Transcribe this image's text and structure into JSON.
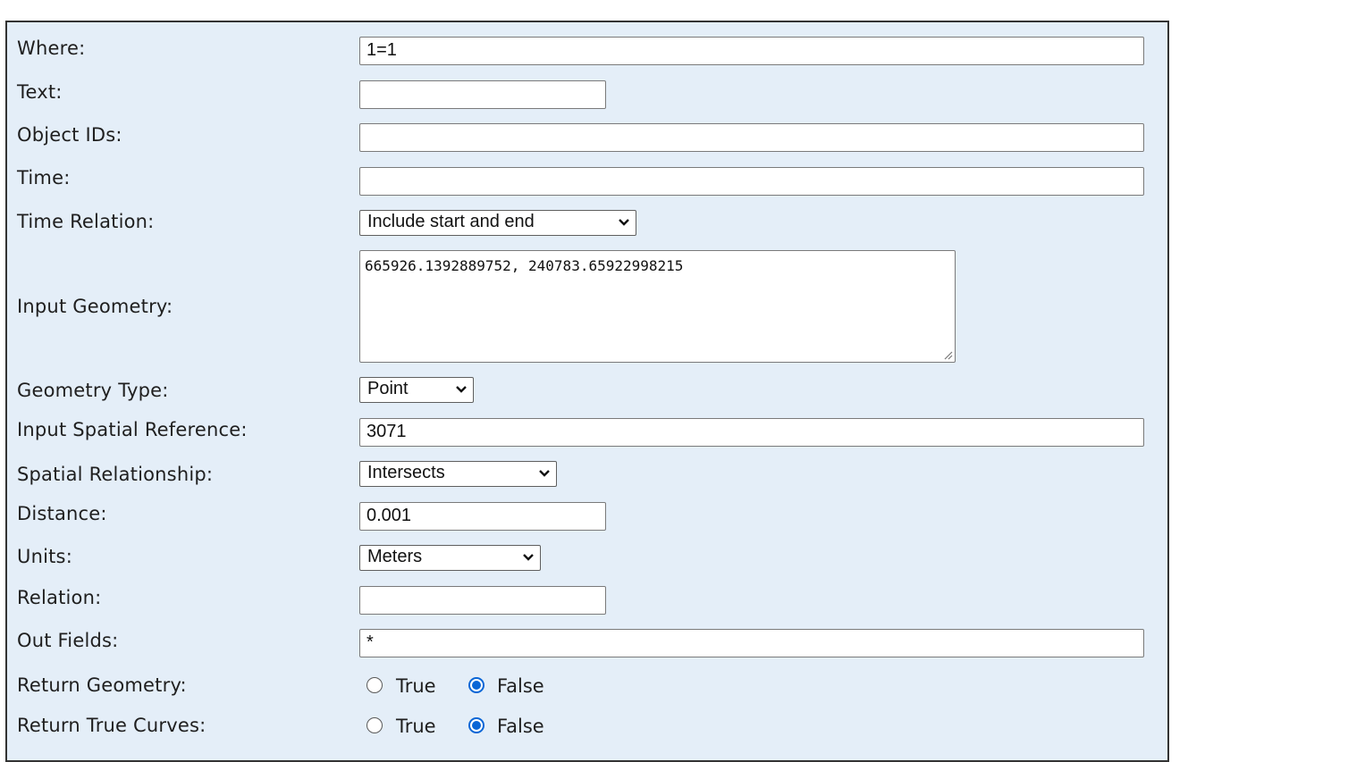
{
  "form": {
    "where": {
      "label": "Where:",
      "value": "1=1"
    },
    "text": {
      "label": "Text:",
      "value": ""
    },
    "object_ids": {
      "label": "Object IDs:",
      "value": ""
    },
    "time": {
      "label": "Time:",
      "value": ""
    },
    "time_relation": {
      "label": "Time Relation:",
      "value": "Include start and end"
    },
    "input_geometry": {
      "label": "Input Geometry:",
      "value": "665926.1392889752, 240783.65922998215"
    },
    "geometry_type": {
      "label": "Geometry Type:",
      "value": "Point"
    },
    "input_spatial_reference": {
      "label": "Input Spatial Reference:",
      "value": "3071"
    },
    "spatial_relationship": {
      "label": "Spatial Relationship:",
      "value": "Intersects"
    },
    "distance": {
      "label": "Distance:",
      "value": "0.001"
    },
    "units": {
      "label": "Units:",
      "value": "Meters"
    },
    "relation": {
      "label": "Relation:",
      "value": ""
    },
    "out_fields": {
      "label": "Out Fields:",
      "value": "*"
    },
    "return_geometry": {
      "label": "Return Geometry:",
      "true_label": "True",
      "false_label": "False",
      "selected": "False"
    },
    "return_true_curves": {
      "label": "Return True Curves:",
      "true_label": "True",
      "false_label": "False",
      "selected": "False"
    }
  },
  "icons": {
    "dropdown": "chevron-down-icon",
    "textarea_resize": "resize-grip-icon"
  },
  "colors": {
    "panel_background": "#e4eef8",
    "radio_accent": "#0a66d6"
  }
}
